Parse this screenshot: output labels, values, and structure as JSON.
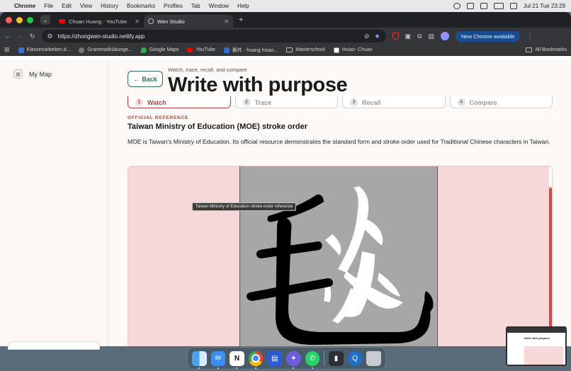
{
  "menubar": {
    "app_name": "Chrome",
    "items": [
      "File",
      "Edit",
      "View",
      "History",
      "Bookmarks",
      "Profiles",
      "Tab",
      "Window",
      "Help"
    ],
    "clock": "Jul 21 Tue  23:29"
  },
  "browser": {
    "tabs": [
      {
        "title": "Chuan Huang - YouTube",
        "icon": "youtube-icon",
        "active": false
      },
      {
        "title": "Wen Studio",
        "icon": "globe-icon",
        "active": true
      }
    ],
    "url": "https://zhongwen-studio.netlify.app",
    "update_button": "New Chrome available",
    "bookmarks": [
      {
        "label": "Klassenarbeiten.d...",
        "color": "#3b6fd4"
      },
      {
        "label": "Grammatikübunge...",
        "color": "#777777"
      },
      {
        "label": "Google Maps",
        "color": "#34a853"
      },
      {
        "label": "YouTube",
        "color": "#ff0000"
      },
      {
        "label": "郵件 - huang hsiao...",
        "color": "#2a6fd6"
      },
      {
        "label": "Masterschool",
        "color": "folder"
      },
      {
        "label": "Hsiao- Chuan",
        "color": "#555555"
      }
    ],
    "all_bookmarks": "All Bookmarks"
  },
  "sidebar": {
    "items": [
      {
        "label": "My Map",
        "icon": "map-icon"
      }
    ]
  },
  "main": {
    "back_label": "Back",
    "kicker": "Watch, trace, recall, and compare",
    "title": "Write with purpose",
    "steps": [
      {
        "num": "1",
        "label": "Watch",
        "active": true
      },
      {
        "num": "2",
        "label": "Trace",
        "active": false
      },
      {
        "num": "3",
        "label": "Recall",
        "active": false
      },
      {
        "num": "4",
        "label": "Compare",
        "active": false
      }
    ],
    "ref_label": "OFFICIAL REFERENCE",
    "ref_heading": "Taiwan Ministry of Education (MOE) stroke order",
    "ref_desc": "MOE is Taiwan's Ministry of Education. Its official resource demonstrates the standard form and stroke order used for Traditional Chinese characters in Taiwan.",
    "tooltip": "Taiwan Ministry of Education stroke-order reference",
    "character": "毯"
  },
  "dock": {
    "apps": [
      "finder",
      "mail",
      "notion",
      "chrome",
      "docs",
      "messenger",
      "whatsapp",
      "app",
      "quicktime",
      "trash"
    ]
  },
  "thumbnail": {
    "title": "Write with purpose"
  }
}
